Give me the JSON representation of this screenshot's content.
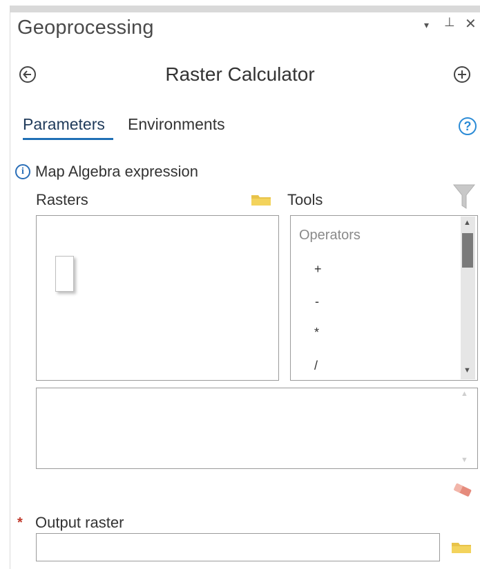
{
  "pane": {
    "title": "Geoprocessing",
    "controls": {
      "menu": "▾",
      "pin": "⊥",
      "close": "✕"
    }
  },
  "tool": {
    "title": "Raster Calculator",
    "back_icon": "back-arrow-icon",
    "add_icon": "plus-icon"
  },
  "tabs": [
    {
      "label": "Parameters",
      "active": true
    },
    {
      "label": "Environments",
      "active": false
    }
  ],
  "help_symbol": "?",
  "expression": {
    "info_symbol": "i",
    "label": "Map Algebra expression",
    "rasters_label": "Rasters",
    "tools_label": "Tools",
    "operators_heading": "Operators",
    "operators": [
      "+",
      "-",
      "*",
      "/"
    ],
    "expression_text": ""
  },
  "output": {
    "required_marker": "*",
    "label": "Output raster",
    "value": ""
  },
  "colors": {
    "accent": "#1f6fb5",
    "required": "#c0392b",
    "folder": "#e8c34a"
  }
}
